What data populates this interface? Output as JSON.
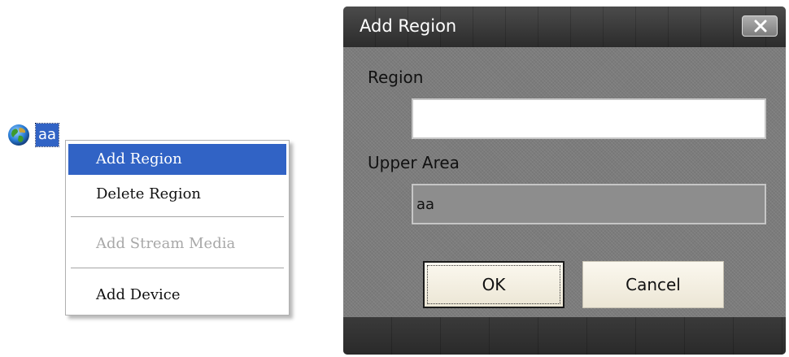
{
  "tree": {
    "node_label": "aa",
    "node_icon": "globe-icon"
  },
  "context_menu": {
    "items": [
      {
        "label": "Add Region",
        "state": "highlighted"
      },
      {
        "label": "Delete Region",
        "state": "enabled"
      },
      {
        "label": "Add Stream Media",
        "state": "disabled"
      },
      {
        "label": "Add Device",
        "state": "enabled"
      }
    ]
  },
  "dialog": {
    "title": "Add Region",
    "close_icon": "close-icon",
    "region_label": "Region",
    "region_value": "",
    "upper_area_label": "Upper Area",
    "upper_area_value": "aa",
    "ok_label": "OK",
    "cancel_label": "Cancel"
  },
  "colors": {
    "selection": "#3163c5",
    "dialog_body": "#7c7c7c",
    "titlebar": "#3a3a3a",
    "button_face": "#f3efe3"
  }
}
